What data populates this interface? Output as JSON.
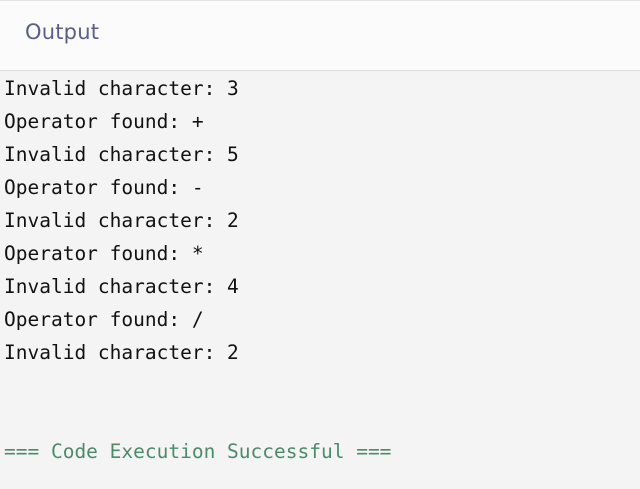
{
  "header": {
    "title": "Output"
  },
  "console": {
    "lines": [
      "Invalid character: 3",
      "Operator found: +",
      "Invalid character: 5",
      "Operator found: -",
      "Invalid character: 2",
      "Operator found: *",
      "Invalid character: 4",
      "Operator found: /",
      "Invalid character: 2"
    ],
    "status_message": "=== Code Execution Successful ===",
    "status_color": "#4a8c6a"
  }
}
